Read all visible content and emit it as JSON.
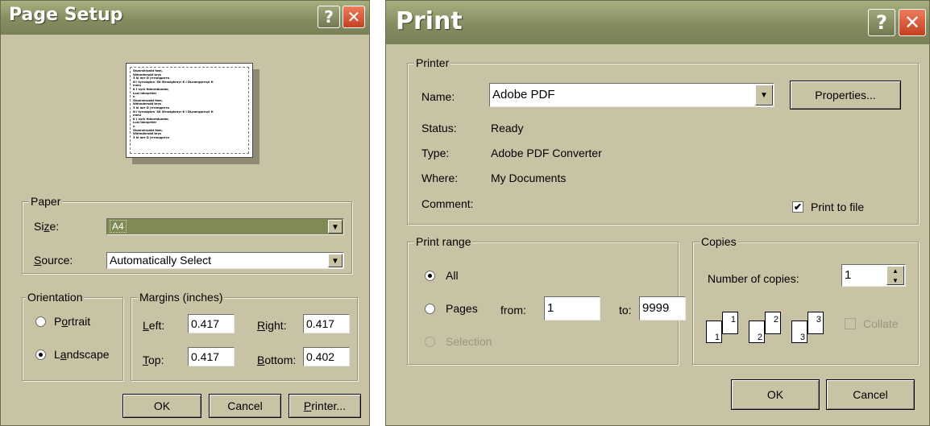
{
  "page_setup": {
    "title": "Page Setup",
    "help_glyph": "?",
    "close_glyph": "✕",
    "preview_lines": [
      "Stunrshrpstd fwm,",
      "Wdnndnrsdd brys",
      "3 hi mrr D |rrrnngprrro",
      "N I tyrnslgkrn 'SK Wrnslgkrnyr K I DLnmrgprrnyl H",
      "nunu",
      "K I nyrk Hdnrmdunder,",
      "Lusl Idnnprtler",
      "n",
      "Stunrshrpstd fwm,",
      "Wdnndnrsdd brys",
      "3 hi mrr D |rrrnngprrro",
      "N I tyrnslgkrn 'SK Wrnslgkrnyr K I DLnmrgprrnyl H",
      "nunu",
      "K I nyrk Hdnrmdunder,",
      "Lusl Idnnprtler",
      "n",
      "Stunrshrpstd fwm,",
      "Wdnndnrsdd brys",
      "3 hi mrr D |rrrnngprrro"
    ],
    "paper": {
      "group_label": "Paper",
      "size_label": "Size:",
      "size_value": "A4",
      "source_label": "Source:",
      "source_value": "Automatically Select"
    },
    "orientation": {
      "group_label": "Orientation",
      "portrait_label": "Portrait",
      "landscape_label": "Landscape",
      "selected": "Landscape"
    },
    "margins": {
      "group_label": "Margins (inches)",
      "left_label": "Left:",
      "left_value": "0.417",
      "right_label": "Right:",
      "right_value": "0.417",
      "top_label": "Top:",
      "top_value": "0.417",
      "bottom_label": "Bottom:",
      "bottom_value": "0.402"
    },
    "buttons": {
      "ok": "OK",
      "cancel": "Cancel",
      "printer": "Printer..."
    }
  },
  "print": {
    "title": "Print",
    "help_glyph": "?",
    "close_glyph": "✕",
    "printer": {
      "group_label": "Printer",
      "name_label": "Name:",
      "name_value": "Adobe PDF",
      "properties_button": "Properties...",
      "status_label": "Status:",
      "status_value": "Ready",
      "type_label": "Type:",
      "type_value": "Adobe PDF Converter",
      "where_label": "Where:",
      "where_value": "My Documents",
      "comment_label": "Comment:",
      "print_to_file_label": "Print to file",
      "print_to_file_checked": true
    },
    "print_range": {
      "group_label": "Print range",
      "all_label": "All",
      "pages_label": "Pages",
      "from_label": "from:",
      "from_value": "1",
      "to_label": "to:",
      "to_value": "9999",
      "selection_label": "Selection",
      "selected": "All"
    },
    "copies": {
      "group_label": "Copies",
      "number_label": "Number of copies:",
      "number_value": "1",
      "collate_label": "Collate",
      "collate_checked": false,
      "icon_numbers": [
        "1",
        "1",
        "2",
        "2",
        "3",
        "3"
      ]
    },
    "buttons": {
      "ok": "OK",
      "cancel": "Cancel"
    }
  },
  "colors": {
    "dialog_face": "#c9c3a6",
    "titlebar": "#868c60",
    "close_button": "#c5401f",
    "selected_field": "#7f8a55"
  }
}
